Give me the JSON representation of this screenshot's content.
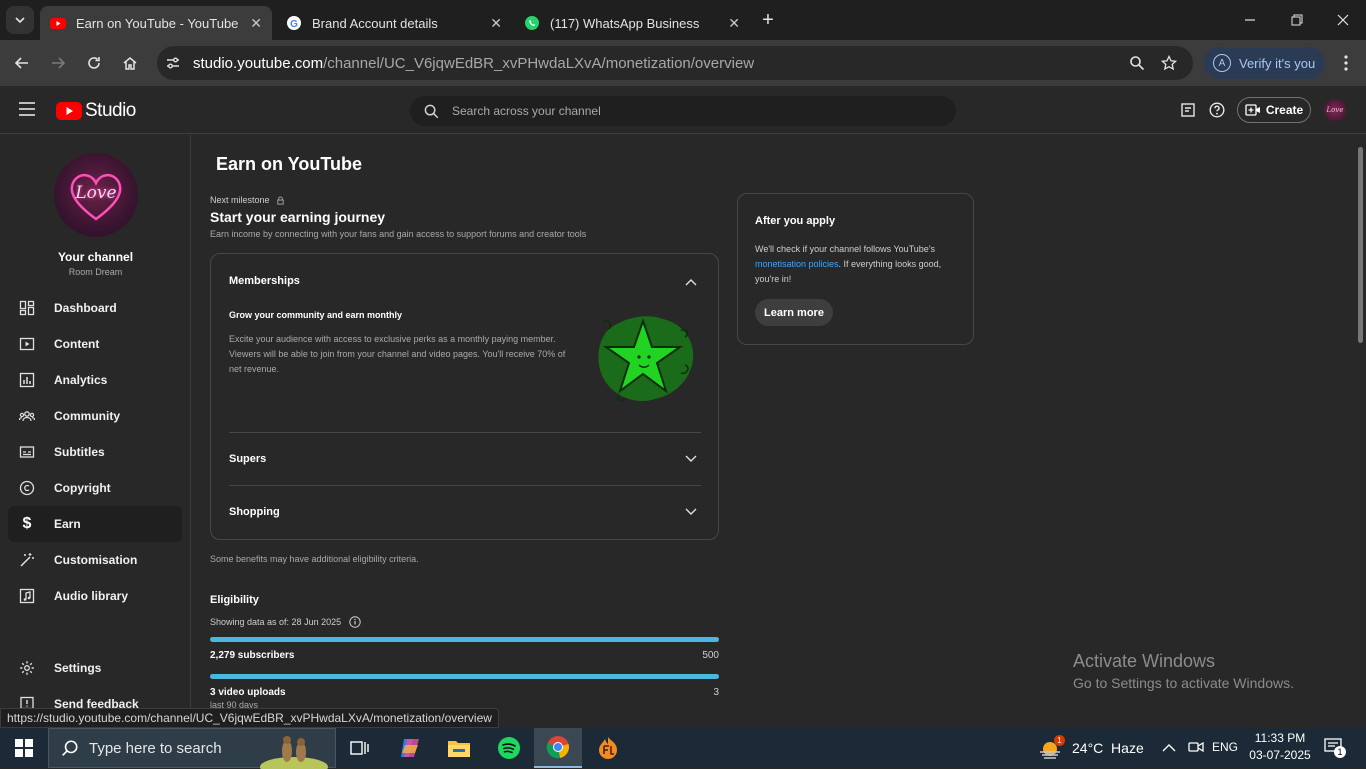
{
  "browser": {
    "tabs": [
      {
        "title": "Earn on YouTube - YouTube Stu",
        "active": true
      },
      {
        "title": "Brand Account details",
        "active": false
      },
      {
        "title": "(117) WhatsApp Business",
        "active": false
      }
    ],
    "url_host": "studio.youtube.com",
    "url_path": "/channel/UC_V6jqwEdBR_xvPHwdaLXvA/monetization/overview",
    "verify_label": "Verify it's you",
    "verify_avatar": "A",
    "status_url": "https://studio.youtube.com/channel/UC_V6jqwEdBR_xvPHwdaLXvA/monetization/overview"
  },
  "studio": {
    "logo_text": "Studio",
    "search_placeholder": "Search across your channel",
    "create_label": "Create",
    "avatar_text": "Love"
  },
  "sidebar": {
    "avatar_text": "Love",
    "channel_label": "Your channel",
    "channel_name": "Room Dream",
    "items": [
      {
        "label": "Dashboard",
        "icon": "dashboard-icon"
      },
      {
        "label": "Content",
        "icon": "content-icon"
      },
      {
        "label": "Analytics",
        "icon": "analytics-icon"
      },
      {
        "label": "Community",
        "icon": "community-icon"
      },
      {
        "label": "Subtitles",
        "icon": "subtitles-icon"
      },
      {
        "label": "Copyright",
        "icon": "copyright-icon"
      },
      {
        "label": "Earn",
        "icon": "dollar-icon",
        "active": true
      },
      {
        "label": "Customisation",
        "icon": "magic-wand-icon"
      },
      {
        "label": "Audio library",
        "icon": "audio-library-icon"
      }
    ],
    "settings_label": "Settings",
    "feedback_label": "Send feedback"
  },
  "main": {
    "page_title": "Earn on YouTube",
    "milestone_label": "Next milestone",
    "milestone_title": "Start your earning journey",
    "milestone_desc": "Earn income by connecting with your fans and gain access to support forums and creator tools",
    "memberships": {
      "title": "Memberships",
      "subtitle": "Grow your community and earn monthly",
      "desc": "Excite your audience with access to exclusive perks as a monthly paying member. Viewers will be able to join from your channel and video pages. You'll receive 70% of net revenue."
    },
    "supers_title": "Supers",
    "shopping_title": "Shopping",
    "benefits_note": "Some benefits may have additional eligibility criteria.",
    "eligibility_title": "Eligibility",
    "eligibility_date": "Showing data as of: 28 Jun 2025",
    "metrics": [
      {
        "label": "2,279 subscribers",
        "target": "500",
        "progress": 1.0
      },
      {
        "label": "3 video uploads",
        "target": "3",
        "sub": "last 90 days",
        "progress": 1.0
      }
    ],
    "apply": {
      "title": "After you apply",
      "text_before": "We'll check if your channel follows YouTube's ",
      "link": "monetisation policies",
      "text_after": ". If everything looks good, you're in!",
      "button": "Learn more"
    }
  },
  "watermark": {
    "title": "Activate Windows",
    "subtitle": "Go to Settings to activate Windows."
  },
  "taskbar": {
    "search_placeholder": "Type here to search",
    "weather": "24°C  Haze",
    "weather_badge": "1",
    "lang": "ENG",
    "time": "11:33 PM",
    "date": "03-07-2025",
    "notif_count": "1"
  },
  "colors": {
    "accent_blue": "#3ea6ff",
    "progress_teal": "#4bb7de",
    "youtube_red": "#ff0000",
    "bg": "#282828"
  }
}
